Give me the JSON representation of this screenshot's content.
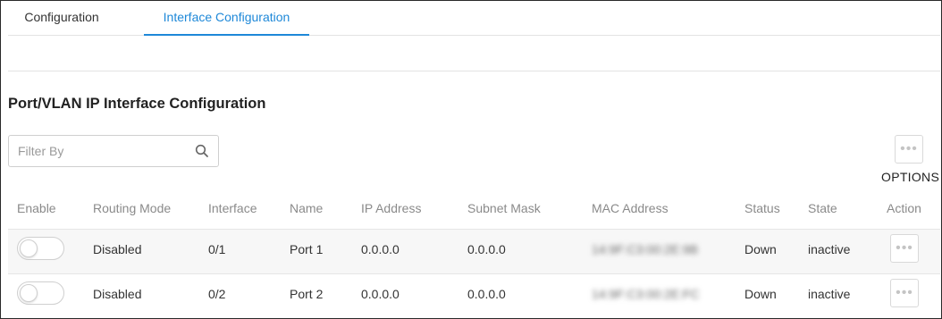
{
  "tabs": [
    {
      "label": "Configuration",
      "active": false
    },
    {
      "label": "Interface Configuration",
      "active": true
    }
  ],
  "section_title": "Port/VLAN IP Interface Configuration",
  "filter": {
    "placeholder": "Filter By",
    "value": ""
  },
  "options_label": "OPTIONS",
  "table": {
    "headers": [
      "Enable",
      "Routing Mode",
      "Interface",
      "Name",
      "IP Address",
      "Subnet Mask",
      "MAC Address",
      "Status",
      "State",
      "Action"
    ],
    "rows": [
      {
        "enabled": false,
        "routing_mode": "Disabled",
        "interface": "0/1",
        "name": "Port 1",
        "ip": "0.0.0.0",
        "mask": "0.0.0.0",
        "mac": "14:9F:C3:00:2E:9B",
        "status": "Down",
        "state": "inactive"
      },
      {
        "enabled": false,
        "routing_mode": "Disabled",
        "interface": "0/2",
        "name": "Port 2",
        "ip": "0.0.0.0",
        "mask": "0.0.0.0",
        "mac": "14:9F:C3:00:2E:FC",
        "status": "Down",
        "state": "inactive"
      }
    ]
  },
  "colors": {
    "accent": "#1e88d8",
    "row_alt": "#f7f7f7"
  },
  "icons": {
    "search": "search-icon",
    "more": "more-horizontal-icon"
  }
}
